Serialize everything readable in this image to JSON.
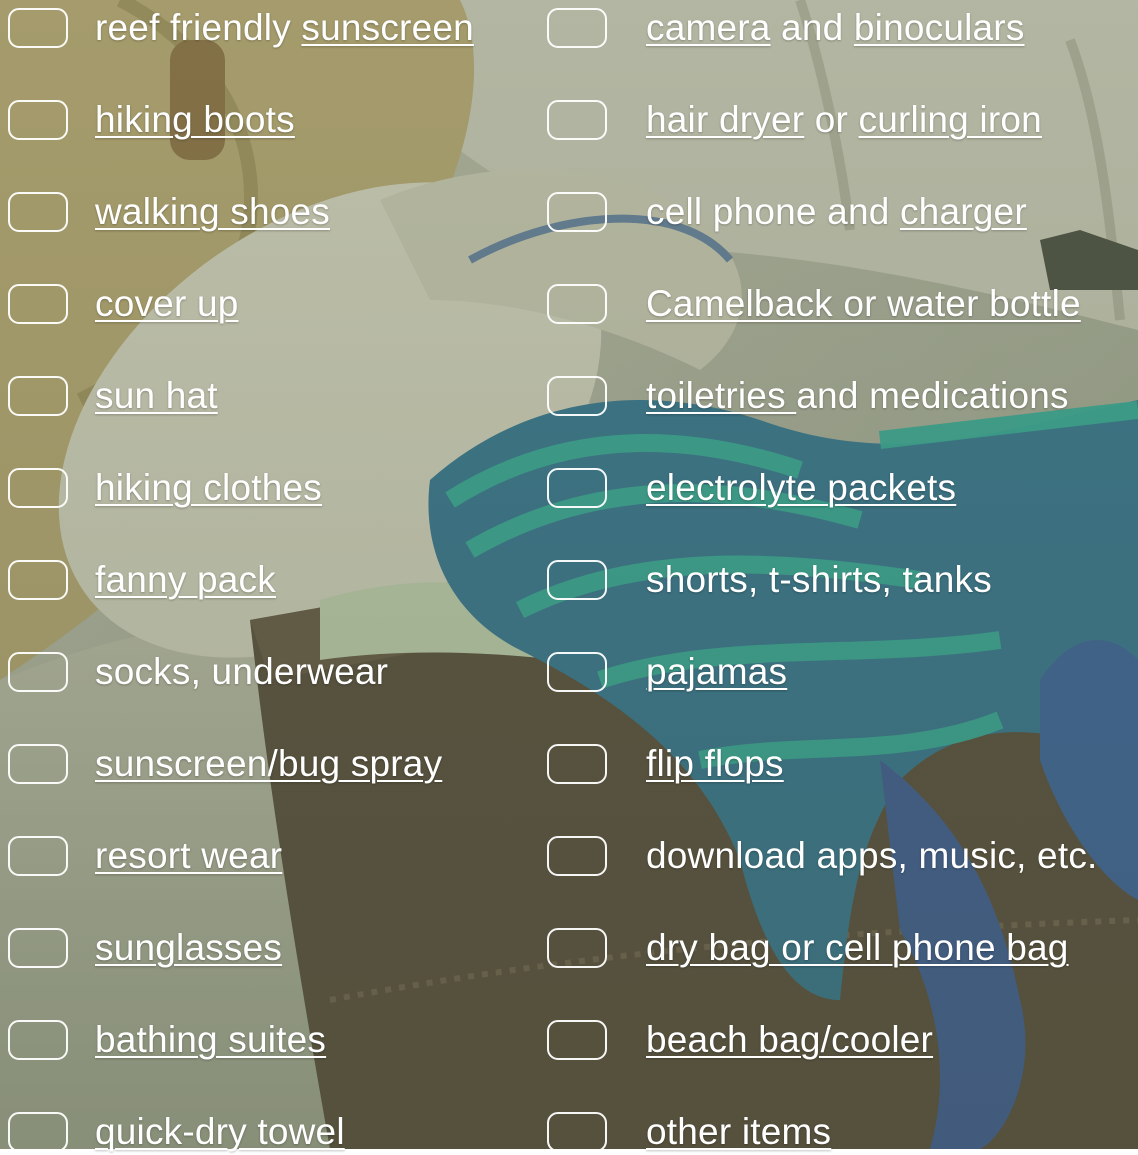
{
  "checklist": {
    "left": [
      {
        "parts": [
          {
            "text": "reef friendly ",
            "link": false
          },
          {
            "text": "sunscreen",
            "link": true
          }
        ]
      },
      {
        "parts": [
          {
            "text": "hiking boots",
            "link": true
          }
        ]
      },
      {
        "parts": [
          {
            "text": "walking shoes",
            "link": true
          }
        ]
      },
      {
        "parts": [
          {
            "text": "cover up",
            "link": true
          }
        ]
      },
      {
        "parts": [
          {
            "text": "sun hat",
            "link": true
          }
        ]
      },
      {
        "parts": [
          {
            "text": "hiking clothes",
            "link": true
          }
        ]
      },
      {
        "parts": [
          {
            "text": "fanny pack ",
            "link": true
          }
        ]
      },
      {
        "parts": [
          {
            "text": "socks, underwear",
            "link": false
          }
        ]
      },
      {
        "parts": [
          {
            "text": "sunscreen/bug spray",
            "link": true
          }
        ]
      },
      {
        "parts": [
          {
            "text": "resort wear",
            "link": true
          }
        ]
      },
      {
        "parts": [
          {
            "text": "sunglasses",
            "link": true
          }
        ]
      },
      {
        "parts": [
          {
            "text": "bathing suites",
            "link": true
          }
        ]
      },
      {
        "parts": [
          {
            "text": "quick-dry towel",
            "link": true
          }
        ]
      }
    ],
    "right": [
      {
        "parts": [
          {
            "text": "camera",
            "link": true
          },
          {
            "text": " and ",
            "link": false
          },
          {
            "text": "binoculars",
            "link": true
          }
        ]
      },
      {
        "parts": [
          {
            "text": "hair dryer",
            "link": true
          },
          {
            "text": " or ",
            "link": false
          },
          {
            "text": "curling iron",
            "link": true
          }
        ]
      },
      {
        "parts": [
          {
            "text": "cell phone and ",
            "link": false
          },
          {
            "text": "charger ",
            "link": true
          }
        ]
      },
      {
        "parts": [
          {
            "text": "Camelback or water bottle",
            "link": true
          }
        ]
      },
      {
        "parts": [
          {
            "text": "toiletries ",
            "link": true
          },
          {
            "text": "and medications",
            "link": false
          }
        ]
      },
      {
        "parts": [
          {
            "text": "electrolyte packets",
            "link": true
          }
        ]
      },
      {
        "parts": [
          {
            "text": "shorts, t-shirts, tanks",
            "link": false
          }
        ]
      },
      {
        "parts": [
          {
            "text": "pajamas",
            "link": true
          }
        ]
      },
      {
        "parts": [
          {
            "text": "flip flops",
            "link": true
          }
        ]
      },
      {
        "parts": [
          {
            "text": "download apps, music, etc.",
            "link": false
          }
        ]
      },
      {
        "parts": [
          {
            "text": "dry bag or cell phone bag",
            "link": true
          }
        ]
      },
      {
        "parts": [
          {
            "text": "beach bag/cooler",
            "link": true
          }
        ]
      },
      {
        "parts": [
          {
            "text": "other items ",
            "link": true
          }
        ]
      }
    ]
  },
  "colors": {
    "text": "#ffffff",
    "checkbox_border": "#ffffff",
    "overlay_tint": "#6f7a5e"
  }
}
